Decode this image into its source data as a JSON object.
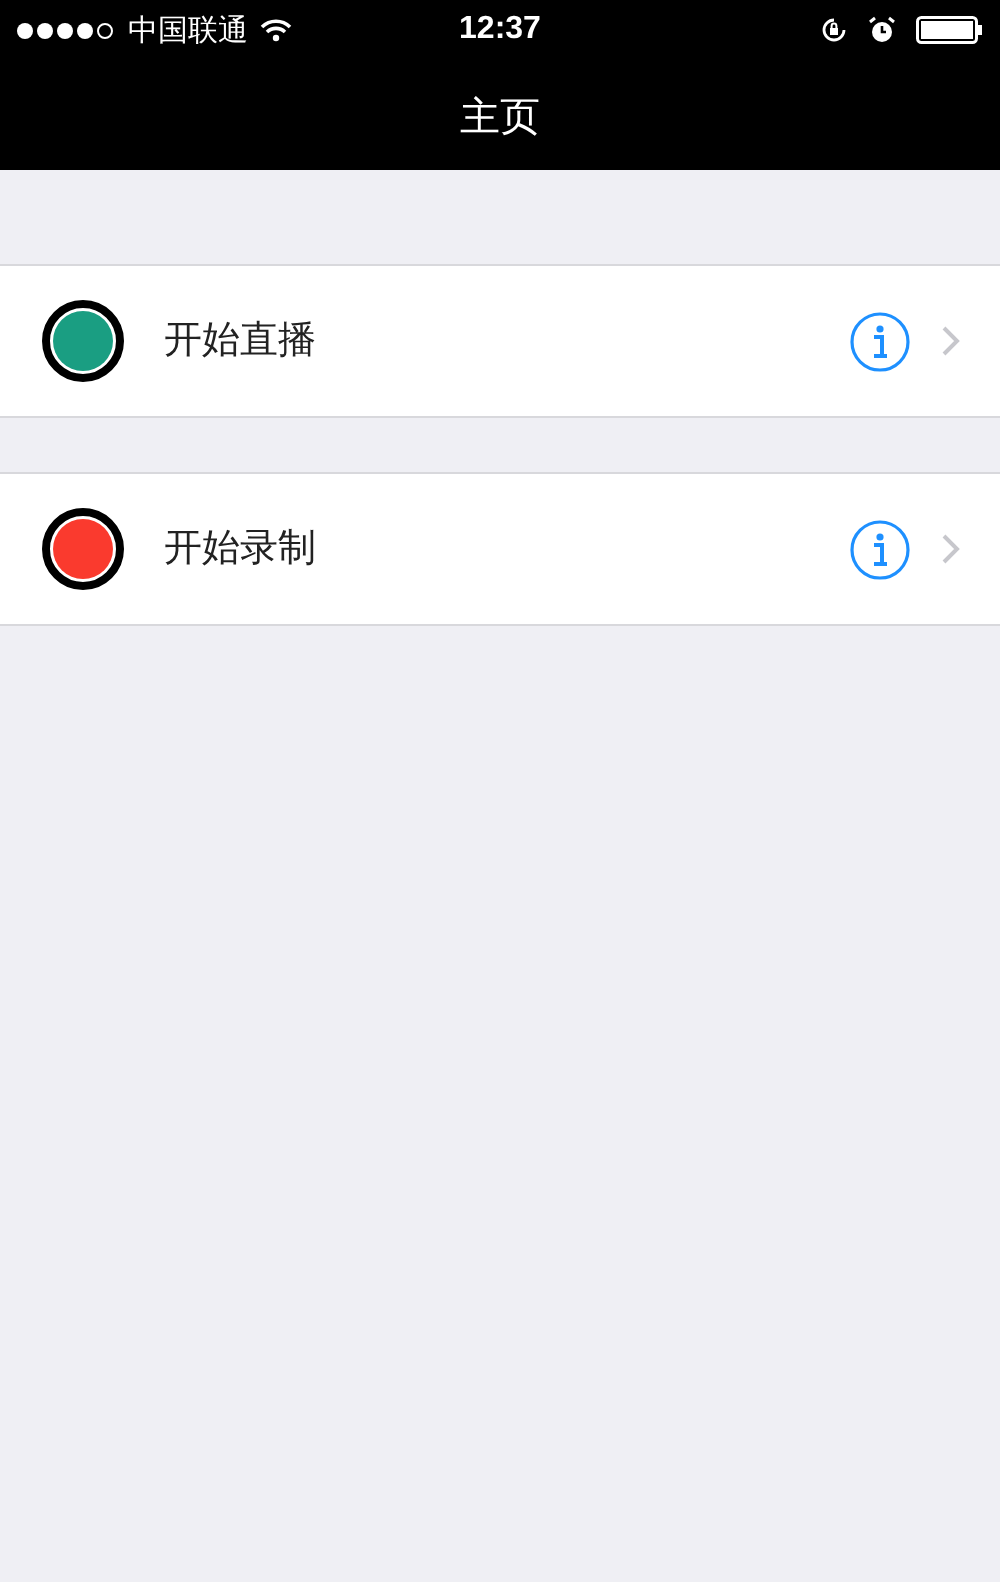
{
  "status_bar": {
    "carrier": "中国联通",
    "time": "12:37"
  },
  "nav_bar": {
    "title": "主页"
  },
  "sections": [
    {
      "label": "开始直播",
      "color": "#1a9e82"
    },
    {
      "label": "开始录制",
      "color": "#fa3a2e"
    }
  ]
}
